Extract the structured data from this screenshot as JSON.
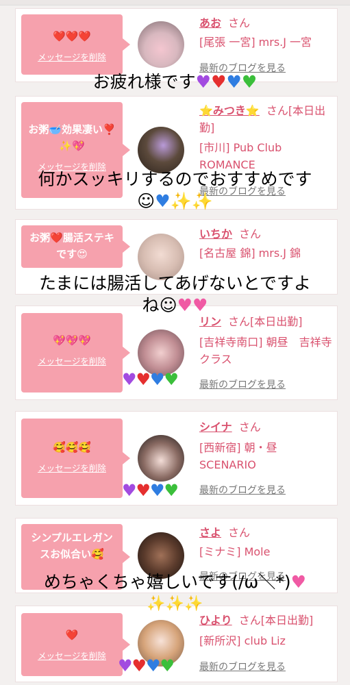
{
  "common": {
    "delete_label": "メッセージを削除",
    "blog_label": "最新のブログを見る",
    "san": "さん"
  },
  "cards": [
    {
      "message": "❤️❤️❤️",
      "name": "あお",
      "suffix": "",
      "info": "[尾張 一宮] mrs.J 一宮"
    },
    {
      "message": "お粥🥣効果凄い❣️✨💖",
      "name": "⭐みつき⭐",
      "suffix": "[本日出勤]",
      "info": "[市川] Pub Club ROMANCE"
    },
    {
      "message": "お粥❤️腸活ステキです😍",
      "name": "いちか",
      "suffix": "",
      "info": "[名古屋 錦] mrs.J 錦"
    },
    {
      "message": "💖💖💖",
      "name": "リン",
      "suffix": "[本日出勤]",
      "info": "[吉祥寺南口] 朝昼　吉祥寺クラス"
    },
    {
      "message": "🥰🥰🥰",
      "name": "シイナ",
      "suffix": "",
      "info": "[西新宿] 朝・昼 SCENARIO"
    },
    {
      "message": "シンプルエレガンスお似合い🥰",
      "name": "さよ",
      "suffix": "",
      "info": "[ミナミ] Mole"
    },
    {
      "message": "❤️",
      "name": "ひより",
      "suffix": "[本日出勤]",
      "info": "[新所沢] club Liz"
    }
  ],
  "overlays": {
    "o1": "お疲れ様です",
    "o2a": "何かスッキリするのでおすすめです",
    "o3a": "たまには腸活してあげないとですよ",
    "o3b": "ね",
    "o4a": "めちゃくちゃ嬉しいです(/ω＼*)"
  },
  "colors": {
    "accent": "#d9516e",
    "bubble": "#f6a1ad"
  }
}
